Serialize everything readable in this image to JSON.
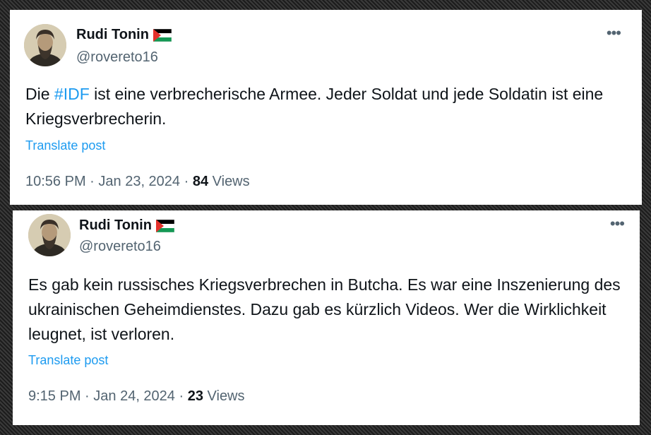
{
  "tweets": [
    {
      "display_name": "Rudi Tonin",
      "flag_icon": "palestine-flag-icon",
      "handle": "@rovereto16",
      "text_before": "Die ",
      "hashtag": "#IDF",
      "text_after": " ist eine verbrecherische Armee. Jeder Soldat und jede Soldatin ist eine Kriegsverbrecherin.",
      "translate_label": "Translate post",
      "time": "10:56 PM",
      "date": "Jan 23, 2024",
      "views_count": "84",
      "views_label": "Views"
    },
    {
      "display_name": "Rudi Tonin",
      "flag_icon": "palestine-flag-icon",
      "handle": "@rovereto16",
      "text": "Es gab kein russisches Kriegsverbrechen in Butcha. Es war eine Inszenierung des ukrainischen Geheimdienstes. Dazu gab es kürzlich Videos. Wer die Wirklichkeit leugnet, ist verloren.",
      "translate_label": "Translate post",
      "time": "9:15 PM",
      "date": "Jan 24, 2024",
      "views_count": "23",
      "views_label": "Views"
    }
  ],
  "separator": " · ",
  "more_icon": "more-options-icon",
  "colors": {
    "link": "#1d9bf0",
    "text": "#0f1419",
    "secondary": "#536471"
  }
}
